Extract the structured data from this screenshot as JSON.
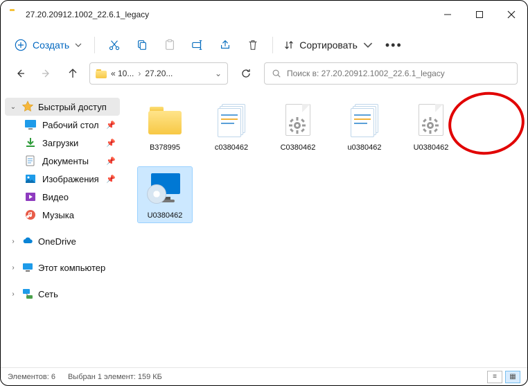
{
  "window": {
    "title": "27.20.20912.1002_22.6.1_legacy"
  },
  "toolbar": {
    "new_label": "Создать",
    "sort_label": "Сортировать"
  },
  "breadcrumb": {
    "crumb1": "« 10...",
    "crumb2": "27.20..."
  },
  "search": {
    "placeholder": "Поиск в: 27.20.20912.1002_22.6.1_legacy"
  },
  "sidebar": {
    "quick_access": "Быстрый доступ",
    "items": [
      {
        "label": "Рабочий стол"
      },
      {
        "label": "Загрузки"
      },
      {
        "label": "Документы"
      },
      {
        "label": "Изображения"
      },
      {
        "label": "Видео"
      },
      {
        "label": "Музыка"
      }
    ],
    "onedrive": "OneDrive",
    "this_pc": "Этот компьютер",
    "network": "Сеть"
  },
  "files": [
    {
      "name": "B378995",
      "type": "folder",
      "selected": false
    },
    {
      "name": "c0380462",
      "type": "config",
      "selected": false
    },
    {
      "name": "C0380462",
      "type": "gearfile",
      "selected": false
    },
    {
      "name": "u0380462",
      "type": "config",
      "selected": false
    },
    {
      "name": "U0380462",
      "type": "gearfile",
      "selected": false
    },
    {
      "name": "U0380462",
      "type": "setup",
      "selected": true
    }
  ],
  "status": {
    "count": "Элементов: 6",
    "selection": "Выбран 1 элемент: 159 КБ"
  }
}
